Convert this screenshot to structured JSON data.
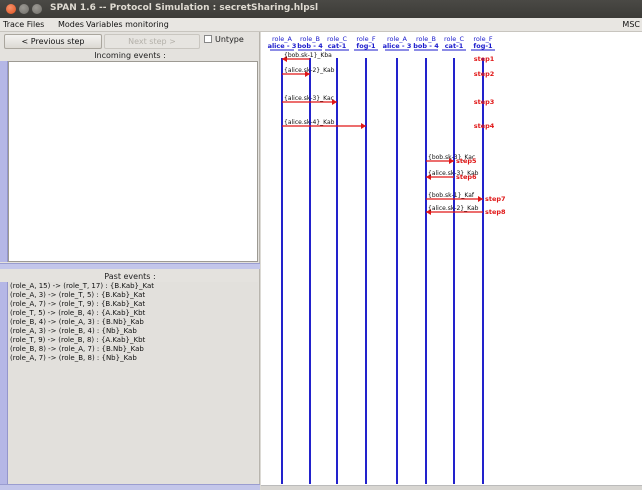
{
  "window": {
    "title": "SPAN 1.6 -- Protocol Simulation : secretSharing.hlpsl"
  },
  "menu": {
    "items": [
      "Trace Files",
      "Modes",
      "Variables monitoring"
    ],
    "right_label": "MSC"
  },
  "controls": {
    "previous_step": "< Previous step",
    "next_step": "Next step >",
    "untype": "Untype"
  },
  "panels": {
    "incoming_title": "Incoming events :",
    "past_title": "Past events :",
    "past_events": [
      "(role_A, 15) -> (role_T, 17) : {B.Kab}_Kat",
      "(role_A, 3) -> (role_T, 5) : {B.Kab}_Kat",
      "(role_A, 7) -> (role_T, 9) : {B.Kab}_Kat",
      "(role_T, 5) -> (role_B, 4) : {A.Kab}_Kbt",
      "(role_B, 4) -> (role_A, 3) : {B.Nb}_Kab",
      "(role_A, 3) -> (role_B, 4) : {Nb}_Kab",
      "(role_T, 9) -> (role_B, 8) : {A.Kab}_Kbt",
      "(role_B, 8) -> (role_A, 7) : {B.Nb}_Kab",
      "(role_A, 7) -> (role_B, 8) : {Nb}_Kab"
    ]
  },
  "msc": {
    "lifelines": [
      {
        "role": "role_A",
        "name": "alice - 3"
      },
      {
        "role": "role_B",
        "name": "bob - 4"
      },
      {
        "role": "role_C",
        "name": "cat-1"
      },
      {
        "role": "role_F",
        "name": "fog-1"
      },
      {
        "role": "role_A",
        "name": "alice - 3"
      },
      {
        "role": "role_B",
        "name": "bob - 4"
      },
      {
        "role": "role_C",
        "name": "cat-1"
      },
      {
        "role": "role_F",
        "name": "fog-1"
      }
    ],
    "messages": [
      {
        "label": "{bob.sk-1}_Kba",
        "from": 1,
        "to": 0,
        "step": "step1",
        "level": 1
      },
      {
        "label": "{alice.sk-2}_Kab",
        "from": 0,
        "to": 1,
        "step": "step2",
        "level": 2
      },
      {
        "label": "{alice.sk-3}_Kac",
        "from": 0,
        "to": 2,
        "step": "step3",
        "level": 3
      },
      {
        "label": "{alice.sk-4}_Kab",
        "from": 0,
        "to": 3,
        "step": "step4",
        "level": 4
      },
      {
        "label": "{bob.sk-3}_Kac",
        "from": 5,
        "to": 6,
        "step": "step5",
        "level": 5
      },
      {
        "label": "{alice.sk-3}_Kab",
        "from": 6,
        "to": 5,
        "step": "step6",
        "level": 6
      },
      {
        "label": "{bob.sk-1}_Kaf",
        "from": 5,
        "to": 7,
        "step": "step7",
        "level": 7
      },
      {
        "label": "{alice.sk-2}_Kab",
        "from": 7,
        "to": 5,
        "step": "step8",
        "level": 8
      }
    ],
    "colors": {
      "lifeline": "#2222cc",
      "header": "#1a1acc",
      "arrow": "#e01616",
      "step": "#e01616",
      "label": "#111111"
    }
  }
}
